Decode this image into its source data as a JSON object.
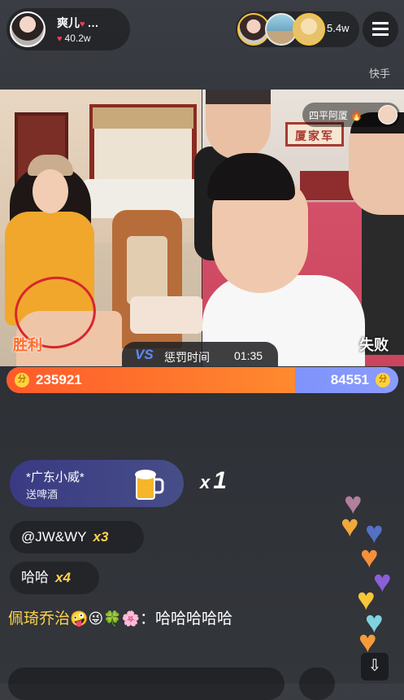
{
  "host": {
    "name": "爽儿",
    "name_suffix": "…",
    "likes": "40.2w"
  },
  "viewers": {
    "count": "5.4w"
  },
  "platform_mark": "快手",
  "pk": {
    "left_result": "胜利",
    "right_result": "失败",
    "opponent_name": "四平阿厦",
    "vs": "VS",
    "penalty_label": "惩罚时间",
    "timer": "01:35",
    "left_score": "235921",
    "right_score": "84551",
    "coin_symbol": "分",
    "banner_text": "厦家军"
  },
  "gift": {
    "sender": "*广东小威*",
    "description": "送啤酒",
    "count_prefix": "x",
    "count": "1"
  },
  "chat": [
    {
      "text": "@JW&WY",
      "mult": "x3"
    },
    {
      "text": "哈哈",
      "mult": "x4"
    }
  ],
  "comment": {
    "user": "佩琦乔治",
    "emojis": "🤪😜🍀🌸",
    "text": "：哈哈哈哈哈"
  },
  "colors": {
    "win_orange": "#ff6a2a",
    "lose_blue": "#6f86f5",
    "highlight_circle": "#d7262e",
    "chat_multiplier": "#ffd34a"
  }
}
